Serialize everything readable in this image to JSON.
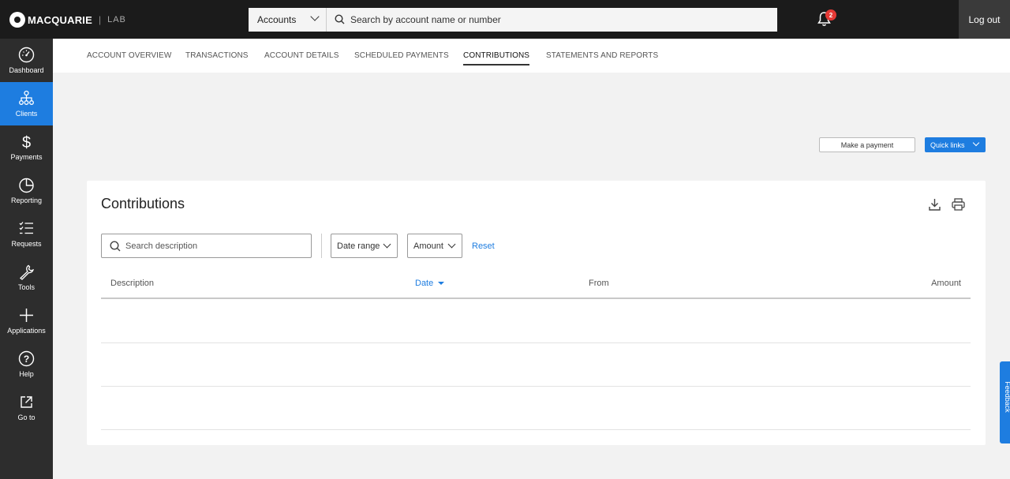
{
  "brand": {
    "name": "MACQUARIE",
    "separator": "|",
    "sub": "LAB"
  },
  "topbar": {
    "account_select": "Accounts",
    "search_placeholder": "Search by account name or number",
    "notification_count": "2",
    "logout": "Log out"
  },
  "sidebar": {
    "items": [
      {
        "label": "Dashboard",
        "icon": "dashboard-icon"
      },
      {
        "label": "Clients",
        "icon": "clients-icon",
        "active": true
      },
      {
        "label": "Payments",
        "icon": "dollar-icon"
      },
      {
        "label": "Reporting",
        "icon": "pie-chart-icon"
      },
      {
        "label": "Requests",
        "icon": "checklist-icon"
      },
      {
        "label": "Tools",
        "icon": "wrench-icon"
      },
      {
        "label": "Applications",
        "icon": "plus-icon"
      },
      {
        "label": "Help",
        "icon": "help-icon"
      },
      {
        "label": "Go to",
        "icon": "external-link-icon"
      }
    ]
  },
  "tabs": [
    {
      "label": "ACCOUNT OVERVIEW"
    },
    {
      "label": "TRANSACTIONS"
    },
    {
      "label": "ACCOUNT DETAILS"
    },
    {
      "label": "SCHEDULED PAYMENTS"
    },
    {
      "label": "CONTRIBUTIONS",
      "active": true
    },
    {
      "label": "STATEMENTS AND REPORTS"
    }
  ],
  "actions": {
    "make_payment": "Make a payment",
    "quick_links": "Quick links"
  },
  "contributions": {
    "title": "Contributions",
    "search_placeholder": "Search description",
    "filters": {
      "date_range": "Date range",
      "amount": "Amount"
    },
    "reset": "Reset",
    "columns": {
      "description": "Description",
      "date": "Date",
      "from": "From",
      "amount": "Amount"
    }
  },
  "feedback": "Feedback",
  "colors": {
    "accent": "#1e7de0",
    "topbar": "#1b1b1b",
    "sidebar": "#2d2d2d",
    "badge": "#e53935"
  }
}
